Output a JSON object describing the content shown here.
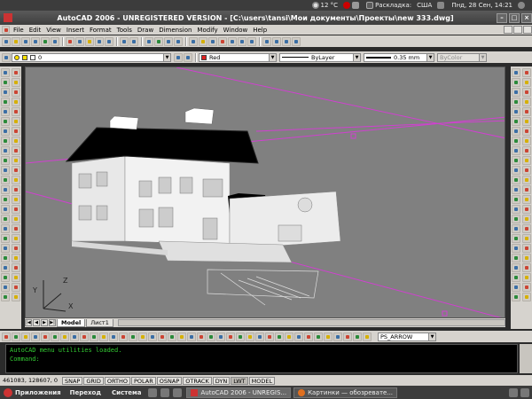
{
  "top_panel": {
    "weather": "12 °C",
    "layout_label": "Раскладка:",
    "layout_value": "США",
    "clock": "Пнд, 28 Сен, 14:21"
  },
  "window": {
    "title": "AutoCAD 2006 - UNREGISTERED VERSION - [C:\\users\\tansi\\Мои документы\\Проекты\\new 333.dwg]"
  },
  "menu": [
    "File",
    "Edit",
    "View",
    "Insert",
    "Format",
    "Tools",
    "Draw",
    "Dimension",
    "Modify",
    "Window",
    "Help"
  ],
  "properties": {
    "layer": "0",
    "color": "Red",
    "color_hex": "#e02020",
    "linetype": "ByLayer",
    "lineweight": "0.35 mm",
    "plotstyle": "ByColor"
  },
  "toolbar2": {
    "dimstyle_value": "PS_ARROW"
  },
  "tabs": [
    "Model",
    "Лист1"
  ],
  "command": {
    "line1": "AutoCAD menu utilities loaded.",
    "line2": "Command:"
  },
  "status": {
    "coords": "461083, 128607, 0",
    "buttons": [
      "SNAP",
      "GRID",
      "ORTHO",
      "POLAR",
      "OSNAP",
      "OTRACK",
      "DYN",
      "LWT",
      "MODEL"
    ]
  },
  "taskbar": {
    "menus": [
      "Приложения",
      "Переход",
      "Система"
    ],
    "tasks": [
      "AutoCAD 2006 - UNREGIS...",
      "Картинки — обозревате..."
    ]
  },
  "ucs": {
    "x": "X",
    "y": "Y",
    "z": "Z"
  }
}
